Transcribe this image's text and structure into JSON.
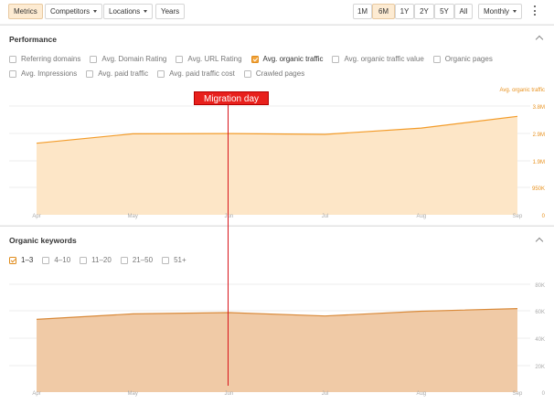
{
  "toolbar": {
    "tabs": [
      "Metrics",
      "Competitors",
      "Locations",
      "Years"
    ],
    "ranges": [
      "1M",
      "6M",
      "1Y",
      "2Y",
      "5Y",
      "All"
    ],
    "active_range": "6M",
    "interval": "Monthly",
    "accent": "#fdebd2"
  },
  "performance": {
    "title": "Performance",
    "checkboxes": [
      {
        "label": "Referring domains",
        "checked": false
      },
      {
        "label": "Avg. Domain Rating",
        "checked": false
      },
      {
        "label": "Avg. URL Rating",
        "checked": false
      },
      {
        "label": "Avg. organic traffic",
        "checked": true
      },
      {
        "label": "Avg. organic traffic value",
        "checked": false
      },
      {
        "label": "Organic pages",
        "checked": false
      },
      {
        "label": "Avg. Impressions",
        "checked": false
      },
      {
        "label": "Avg. paid traffic",
        "checked": false
      },
      {
        "label": "Avg. paid traffic cost",
        "checked": false
      },
      {
        "label": "Crawled pages",
        "checked": false
      }
    ]
  },
  "keywords": {
    "title": "Organic keywords",
    "checkboxes": [
      {
        "label": "1–3",
        "checked": true
      },
      {
        "label": "4–10",
        "checked": false
      },
      {
        "label": "11–20",
        "checked": false
      },
      {
        "label": "21–50",
        "checked": false
      },
      {
        "label": "51+",
        "checked": false
      }
    ]
  },
  "annotation": {
    "label": "Migration day",
    "color": "#e8201c"
  },
  "chart_data": [
    {
      "type": "area",
      "x": [
        "Apr",
        "May",
        "Jun",
        "Jul",
        "Aug",
        "Sep"
      ],
      "series": [
        {
          "name": "Avg. organic traffic",
          "values": [
            2500000,
            2830000,
            2840000,
            2810000,
            3030000,
            3440000
          ]
        }
      ],
      "yticks": [
        "3.8M",
        "2.9M",
        "1.9M",
        "950K",
        "0"
      ],
      "ylim": [
        0,
        3800000
      ],
      "color": "#f39c2a",
      "fill": "#fde6c7",
      "grid": true
    },
    {
      "type": "area",
      "x": [
        "Apr",
        "May",
        "Jun",
        "Jul",
        "Aug",
        "Sep"
      ],
      "series": [
        {
          "name": "",
          "values": [
            54000,
            58000,
            59000,
            56500,
            60000,
            62000
          ]
        }
      ],
      "yticks": [
        "80K",
        "60K",
        "40K",
        "20K",
        "0"
      ],
      "ylim": [
        0,
        80000
      ],
      "color": "#d98a3a",
      "fill": "#f0caa6",
      "grid": true
    }
  ]
}
